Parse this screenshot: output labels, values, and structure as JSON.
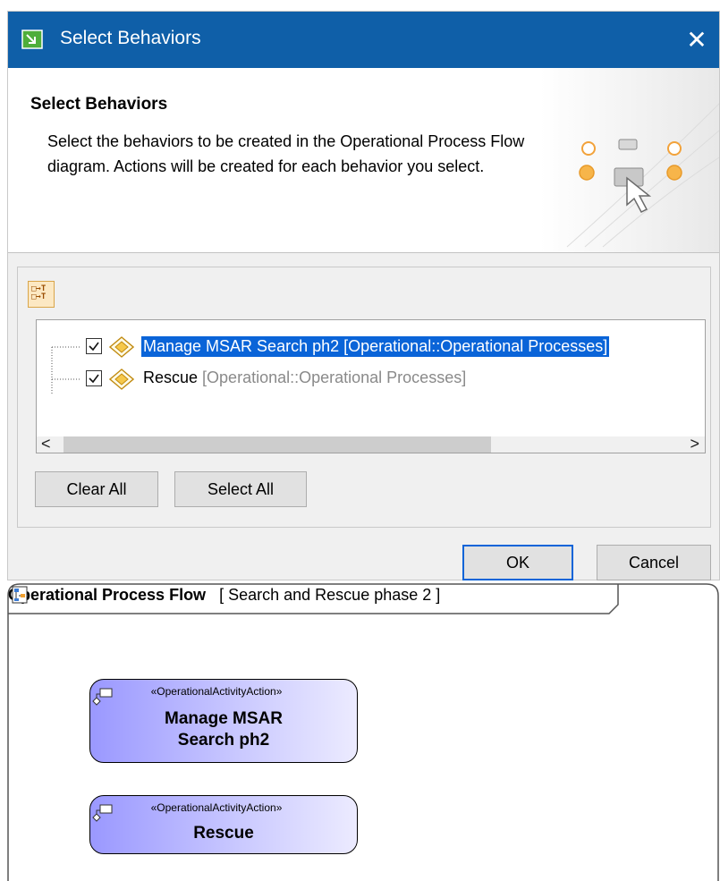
{
  "dialog": {
    "window_title": "Select Behaviors",
    "close_glyph": "✕",
    "heading": "Select Behaviors",
    "description": "Select the behaviors to be created in the Operational Process Flow diagram. Actions will be created for each behavior you select.",
    "tree": [
      {
        "name": "Manage MSAR Search ph2",
        "qualifier": "[Operational::Operational Processes]",
        "checked": true,
        "selected": true
      },
      {
        "name": "Rescue",
        "qualifier": "[Operational::Operational Processes]",
        "checked": true,
        "selected": false
      }
    ],
    "buttons": {
      "clear_all": "Clear All",
      "select_all": "Select All",
      "ok": "OK",
      "cancel": "Cancel"
    },
    "scroll_left": "<",
    "scroll_right": ">"
  },
  "diagram": {
    "kind": "Operational Process Flow",
    "bracket_open": "[",
    "name": "Search and Rescue phase 2",
    "bracket_close": "]",
    "actions": [
      {
        "stereotype": "«OperationalActivityAction»",
        "name_line1": "Manage MSAR",
        "name_line2": "Search ph2"
      },
      {
        "stereotype": "«OperationalActivityAction»",
        "name_line1": "Rescue"
      }
    ]
  },
  "colors": {
    "titlebar": "#0f5fa8",
    "selection": "#0a64d8",
    "action_fill_start": "#9a98ff",
    "action_fill_end": "#ecebff"
  }
}
